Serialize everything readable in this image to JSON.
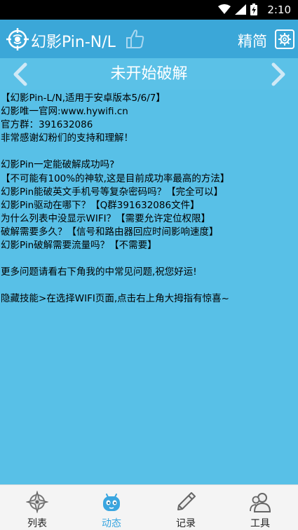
{
  "status_bar": {
    "time": "2:10"
  },
  "app_bar": {
    "title": "幻影Pin-N/L",
    "simplify_label": "精简"
  },
  "banner": {
    "title": "未开始破解"
  },
  "content": {
    "lines": [
      "【幻影Pin-L/N,适用于安卓版本5/6/7】",
      "幻影唯一官网:www.hywifi.cn",
      "官方群：391632086",
      "非常感谢幻粉们的支持和理解！",
      "",
      "幻影Pin一定能破解成功吗?",
      "【不可能有100%的神软,这是目前成功率最高的方法】",
      "幻影Pin能破英文手机号等复杂密码吗？【完全可以】",
      "幻影Pin驱动在哪下？【Q群391632086文件】",
      "为什么列表中没显示WIFI？【需要允许定位权限】",
      "破解需要多久？【信号和路由器回应时间影响速度】",
      "幻影Pin破解需要流量吗？【不需要】",
      "",
      "更多问题请看右下角我的中常见问题,祝您好运!",
      "",
      "隐藏技能>在选择WIFI页面,点击右上角大拇指有惊喜~"
    ]
  },
  "tabs": [
    {
      "label": "列表",
      "icon": "compass-icon",
      "active": false
    },
    {
      "label": "动态",
      "icon": "robot-icon",
      "active": true
    },
    {
      "label": "记录",
      "icon": "pencil-icon",
      "active": false
    },
    {
      "label": "工具",
      "icon": "users-icon",
      "active": false
    }
  ],
  "colors": {
    "app_bar": "#3ba7d8",
    "background": "#56c1e8",
    "active_tab": "#3aa6e0"
  }
}
